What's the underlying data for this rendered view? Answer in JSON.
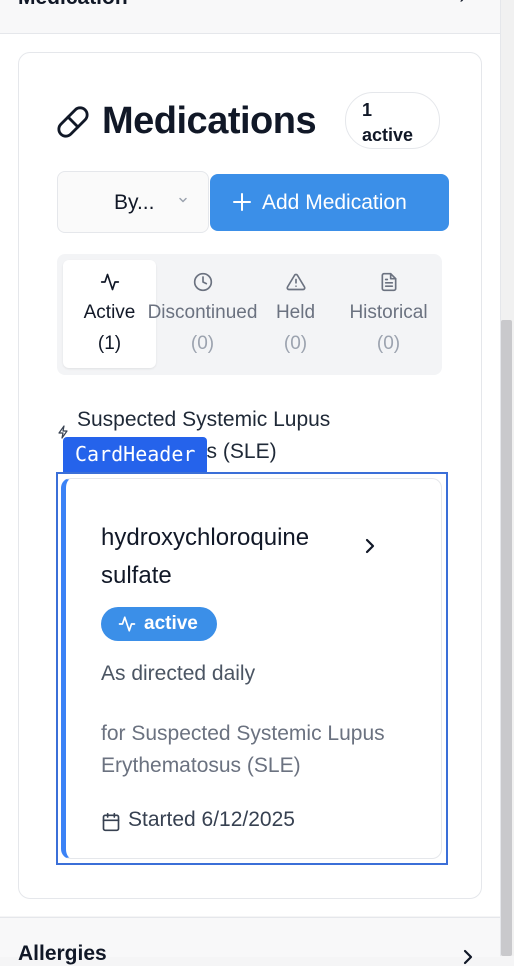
{
  "top_section": {
    "title": "Medication",
    "chevron": "›"
  },
  "card": {
    "title": "Medications",
    "count_number": "1",
    "count_word": "active",
    "sort_label": "By...",
    "add_button_label": "Add Medication"
  },
  "tabs": [
    {
      "label": "Active",
      "count": "(1)",
      "icon": "activity-icon",
      "selected": true
    },
    {
      "label": "Discontinued",
      "count": "(0)",
      "icon": "clock-icon",
      "selected": false
    },
    {
      "label": "Held",
      "count": "(0)",
      "icon": "alert-triangle-icon",
      "selected": false
    },
    {
      "label": "Historical",
      "count": "(0)",
      "icon": "file-text-icon",
      "selected": false
    }
  ],
  "group": {
    "label": "Suspected Systemic Lupus Erythematosus (SLE)"
  },
  "overlay_tag": "CardHeader",
  "medication": {
    "name": "hydroxychloroquine sulfate",
    "status": "active",
    "dosage": "As directed daily",
    "indication": "for Suspected Systemic Lupus Erythematosus (SLE)",
    "started": "Started 6/12/2025"
  },
  "bottom_section": {
    "title": "Allergies"
  },
  "colors": {
    "accent": "#3b8fe8",
    "overlay": "#2563eb",
    "card_border_left": "#3b82f6"
  }
}
